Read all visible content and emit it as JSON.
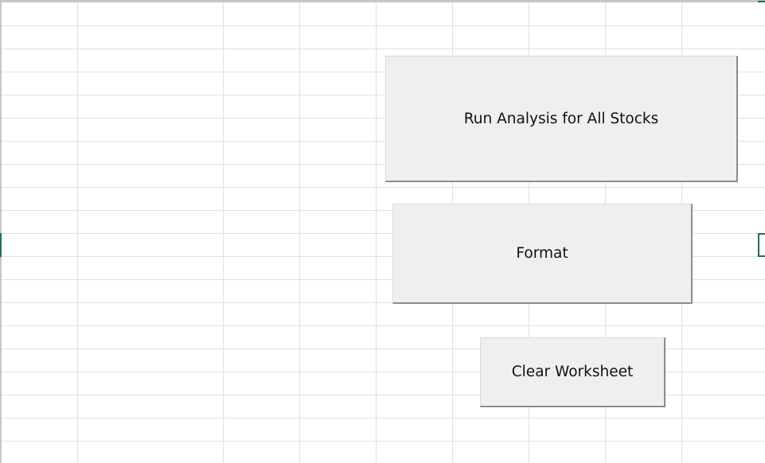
{
  "sheet": {
    "gridline_color": "#e1e1e1",
    "selection_color": "#217346"
  },
  "buttons": {
    "run_analysis_label": "Run Analysis for All Stocks",
    "format_label": "Format",
    "clear_label": "Clear Worksheet",
    "face_color": "#efefef"
  }
}
